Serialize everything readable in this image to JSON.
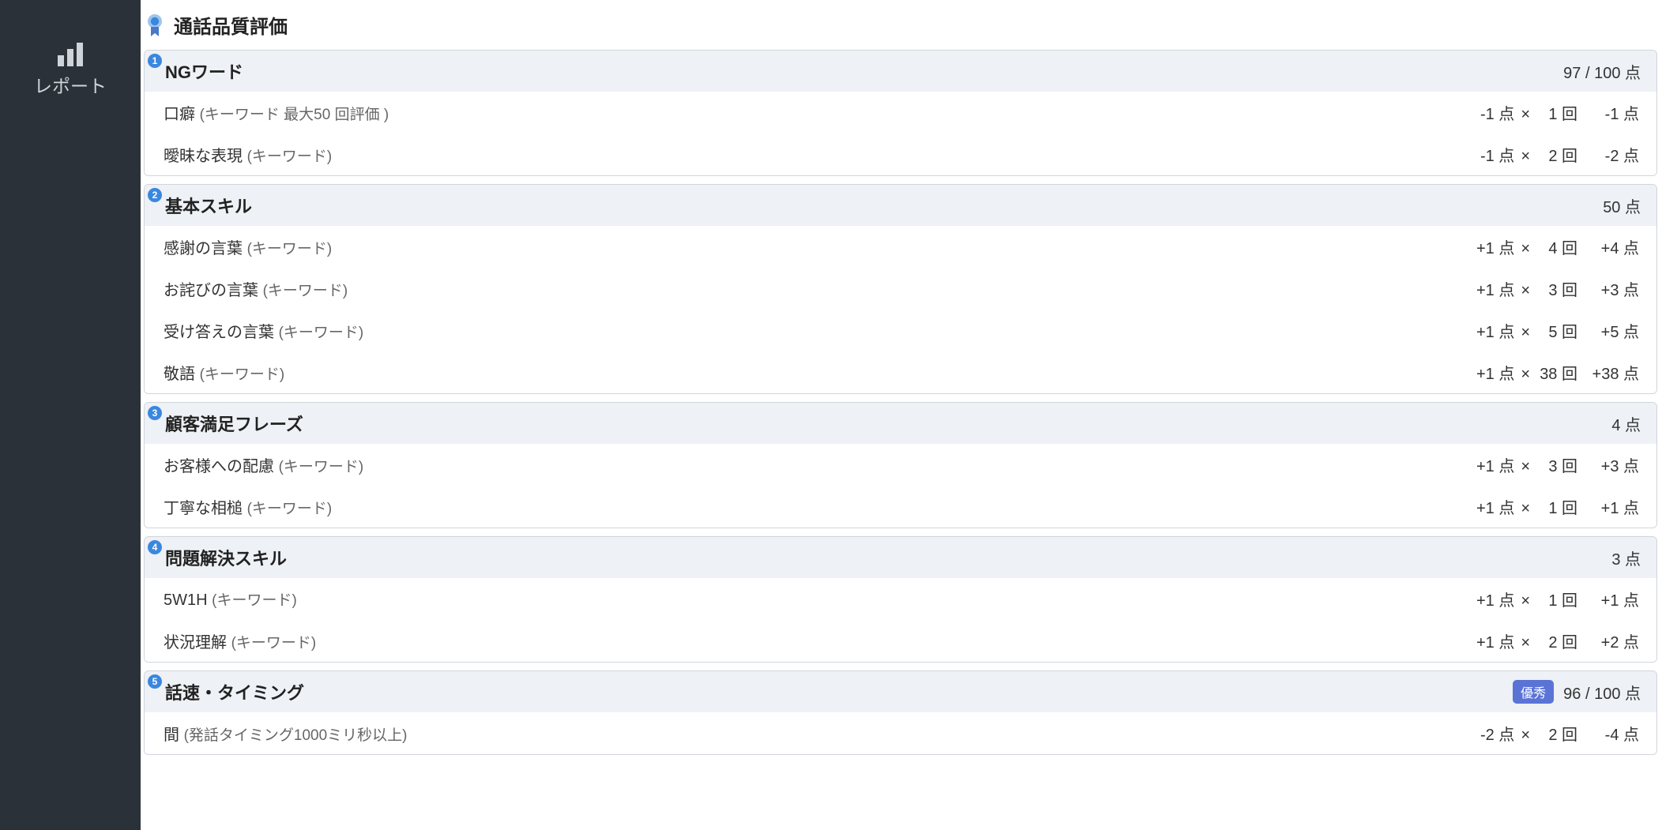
{
  "sidebar": {
    "report_label": "レポート"
  },
  "section": {
    "title": "通話品質評価"
  },
  "cards": [
    {
      "num": "1",
      "title": "NGワード",
      "score": "97 / 100 点",
      "tag": null,
      "rows": [
        {
          "label": "口癖",
          "sub": "(キーワード 最大50 回評価 )",
          "unit": "-1 点",
          "times": "×",
          "count": "1 回",
          "total": "-1 点"
        },
        {
          "label": "曖昧な表現",
          "sub": "(キーワード)",
          "unit": "-1 点",
          "times": "×",
          "count": "2 回",
          "total": "-2 点"
        }
      ]
    },
    {
      "num": "2",
      "title": "基本スキル",
      "score": "50 点",
      "tag": null,
      "rows": [
        {
          "label": "感謝の言葉",
          "sub": "(キーワード)",
          "unit": "+1 点",
          "times": "×",
          "count": "4 回",
          "total": "+4 点"
        },
        {
          "label": "お詫びの言葉",
          "sub": "(キーワード)",
          "unit": "+1 点",
          "times": "×",
          "count": "3 回",
          "total": "+3 点"
        },
        {
          "label": "受け答えの言葉",
          "sub": "(キーワード)",
          "unit": "+1 点",
          "times": "×",
          "count": "5 回",
          "total": "+5 点"
        },
        {
          "label": "敬語",
          "sub": "(キーワード)",
          "unit": "+1 点",
          "times": "×",
          "count": "38 回",
          "total": "+38 点"
        }
      ]
    },
    {
      "num": "3",
      "title": "顧客満足フレーズ",
      "score": "4 点",
      "tag": null,
      "rows": [
        {
          "label": "お客様への配慮",
          "sub": "(キーワード)",
          "unit": "+1 点",
          "times": "×",
          "count": "3 回",
          "total": "+3 点"
        },
        {
          "label": "丁寧な相槌",
          "sub": "(キーワード)",
          "unit": "+1 点",
          "times": "×",
          "count": "1 回",
          "total": "+1 点"
        }
      ]
    },
    {
      "num": "4",
      "title": "問題解決スキル",
      "score": "3 点",
      "tag": null,
      "rows": [
        {
          "label": "5W1H",
          "sub": "(キーワード)",
          "unit": "+1 点",
          "times": "×",
          "count": "1 回",
          "total": "+1 点"
        },
        {
          "label": "状況理解",
          "sub": "(キーワード)",
          "unit": "+1 点",
          "times": "×",
          "count": "2 回",
          "total": "+2 点"
        }
      ]
    },
    {
      "num": "5",
      "title": "話速・タイミング",
      "score": "96 / 100 点",
      "tag": "優秀",
      "rows": [
        {
          "label": "間",
          "sub": "(発話タイミング1000ミリ秒以上)",
          "unit": "-2 点",
          "times": "×",
          "count": "2 回",
          "total": "-4 点"
        }
      ]
    }
  ]
}
